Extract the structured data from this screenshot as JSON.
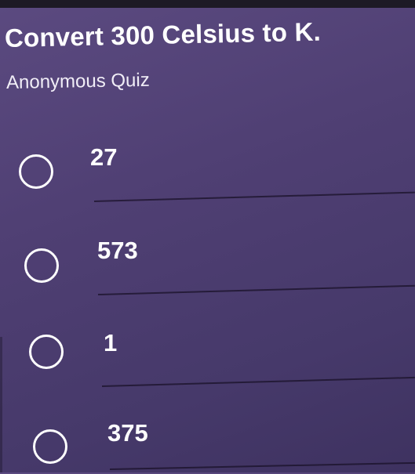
{
  "quiz": {
    "question": "Convert 300 Celsius to K.",
    "subtitle": "Anonymous Quiz",
    "options": [
      {
        "label": "27"
      },
      {
        "label": "573"
      },
      {
        "label": "1"
      },
      {
        "label": "375"
      }
    ]
  },
  "colors": {
    "background": "#4f3f73",
    "text": "#ffffff",
    "divider": "#191228"
  }
}
